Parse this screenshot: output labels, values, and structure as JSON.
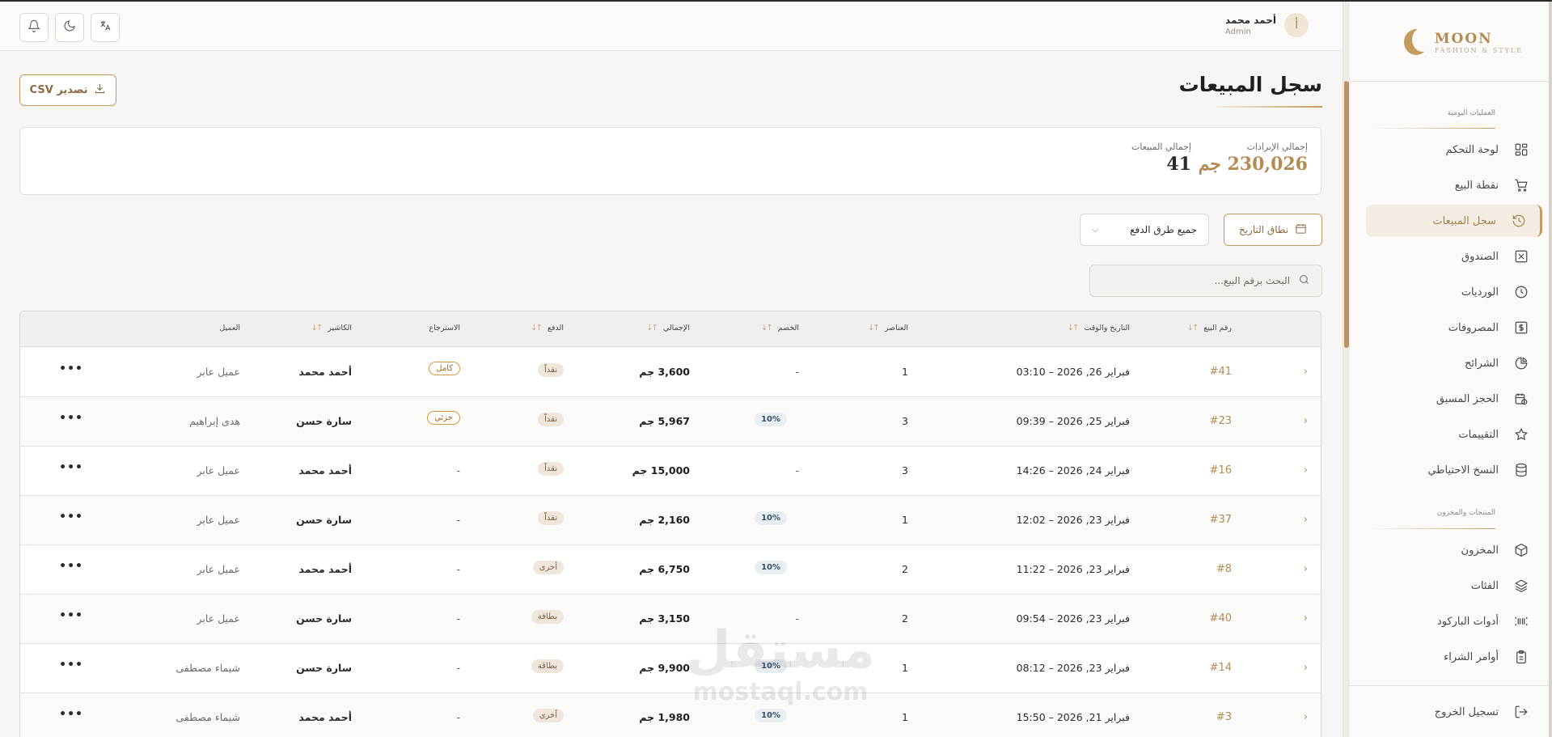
{
  "brand": {
    "name": "MOON",
    "tagline": "FASHION & STYLE"
  },
  "topbar": {
    "user_name": "أحمد محمد",
    "user_role": "Admin",
    "avatar_letter": "أ",
    "icons": [
      "notifications-icon",
      "theme-toggle-icon",
      "language-icon"
    ]
  },
  "sidebar": {
    "section_daily": "العمليات اليومية",
    "section_products": "المنتجات والمخزون",
    "items": [
      {
        "label": "لوحة التحكم",
        "icon": "dashboard-icon"
      },
      {
        "label": "نقطة البيع",
        "icon": "cart-icon"
      },
      {
        "label": "سجل المبيعات",
        "icon": "history-icon",
        "active": true
      },
      {
        "label": "الصندوق",
        "icon": "cash-box-icon"
      },
      {
        "label": "الورديات",
        "icon": "clock-icon"
      },
      {
        "label": "المصروفات",
        "icon": "expenses-icon"
      },
      {
        "label": "الشرائح",
        "icon": "pie-chart-icon"
      },
      {
        "label": "الحجز المسبق",
        "icon": "calendar-clock-icon"
      },
      {
        "label": "التقييمات",
        "icon": "star-icon"
      },
      {
        "label": "النسخ الاحتياطي",
        "icon": "database-icon"
      }
    ],
    "product_items": [
      {
        "label": "المخزون",
        "icon": "box-icon"
      },
      {
        "label": "الفئات",
        "icon": "layers-icon"
      },
      {
        "label": "أدوات الباركود",
        "icon": "barcode-icon"
      },
      {
        "label": "أوامر الشراء",
        "icon": "clipboard-icon"
      }
    ],
    "logout": "تسجيل الخروج"
  },
  "main": {
    "title": "سجل المبيعات",
    "export_label": "تصدير CSV",
    "stats": {
      "revenue_label": "إجمالي الإيرادات",
      "revenue_value": "230,026 جم",
      "sales_label": "إجمالي المبيعات",
      "sales_value": "41"
    },
    "filters": {
      "date_range": "نطاق التاريخ",
      "payment_methods": "جميع طرق الدفع"
    },
    "search_placeholder": "البحث برقم البيع..."
  },
  "table": {
    "headers": {
      "id": "رقم البيع",
      "datetime": "التاريخ والوقت",
      "items": "العناصر",
      "discount": "الخصم",
      "total": "الإجمالي",
      "payment": "الدفع",
      "refund": "الاسترجاع",
      "cashier": "الكاشير",
      "customer": "العميل"
    },
    "rows": [
      {
        "id": "#41",
        "datetime": "فبراير 26, 2026 – 03:10",
        "items": "1",
        "discount": "-",
        "total": "3,600 جم",
        "payment": "نقداً",
        "refund": "كامل",
        "cashier": "أحمد محمد",
        "customer": "عميل عابر"
      },
      {
        "id": "#23",
        "datetime": "فبراير 25, 2026 – 09:39",
        "items": "3",
        "discount": "10%",
        "total": "5,967 جم",
        "payment": "نقداً",
        "refund": "جزئي",
        "cashier": "سارة حسن",
        "customer": "هدى إبراهيم"
      },
      {
        "id": "#16",
        "datetime": "فبراير 24, 2026 – 14:26",
        "items": "3",
        "discount": "-",
        "total": "15,000 جم",
        "payment": "نقداً",
        "refund": "-",
        "cashier": "أحمد محمد",
        "customer": "عميل عابر"
      },
      {
        "id": "#37",
        "datetime": "فبراير 23, 2026 – 12:02",
        "items": "1",
        "discount": "10%",
        "total": "2,160 جم",
        "payment": "نقداً",
        "refund": "-",
        "cashier": "سارة حسن",
        "customer": "عميل عابر"
      },
      {
        "id": "#8",
        "datetime": "فبراير 23, 2026 – 11:22",
        "items": "2",
        "discount": "10%",
        "total": "6,750 جم",
        "payment": "أخرى",
        "refund": "-",
        "cashier": "أحمد محمد",
        "customer": "عميل عابر"
      },
      {
        "id": "#40",
        "datetime": "فبراير 23, 2026 – 09:54",
        "items": "2",
        "discount": "-",
        "total": "3,150 جم",
        "payment": "بطاقة",
        "refund": "-",
        "cashier": "سارة حسن",
        "customer": "عميل عابر"
      },
      {
        "id": "#14",
        "datetime": "فبراير 23, 2026 – 08:12",
        "items": "1",
        "discount": "10%",
        "total": "9,900 جم",
        "payment": "بطاقة",
        "refund": "-",
        "cashier": "سارة حسن",
        "customer": "شيماء مصطفى"
      },
      {
        "id": "#3",
        "datetime": "فبراير 21, 2026 – 15:50",
        "items": "1",
        "discount": "10%",
        "total": "1,980 جم",
        "payment": "أخرى",
        "refund": "-",
        "cashier": "أحمد محمد",
        "customer": "شيماء مصطفى"
      }
    ]
  },
  "watermark": {
    "ar": "مستقل",
    "en": "mostaql.com"
  },
  "colors": {
    "accent": "#c49a5d",
    "accent_dark": "#a7804f",
    "discount_badge": "#e9eef3",
    "payment_badge": "#efe7db"
  }
}
